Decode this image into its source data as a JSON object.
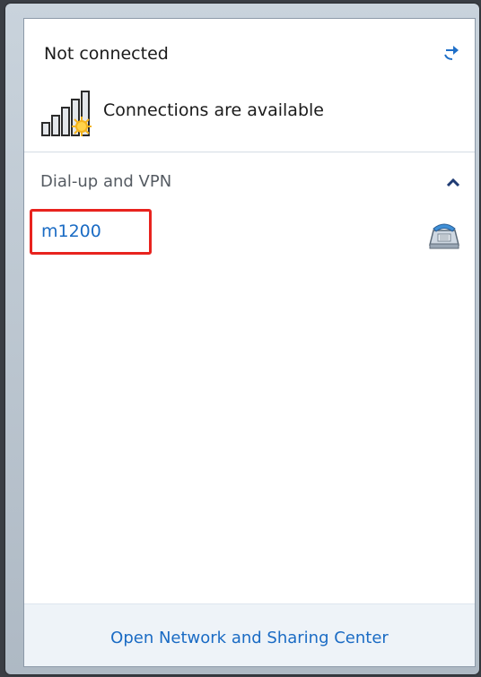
{
  "header": {
    "status_title": "Not connected",
    "refresh_icon": "refresh-arrows-icon"
  },
  "connection": {
    "icon": "signal-bars-available-icon",
    "text": "Connections are available"
  },
  "section": {
    "label": "Dial-up and VPN",
    "collapse_icon": "chevron-up-icon",
    "items": [
      {
        "label": "m1200",
        "icon": "dialup-phone-icon",
        "highlighted": true
      }
    ]
  },
  "footer": {
    "link": "Open Network and Sharing Center"
  },
  "colors": {
    "link": "#1a6bc4",
    "highlight_border": "#e8231e",
    "footer_bg": "#eef3f8"
  }
}
